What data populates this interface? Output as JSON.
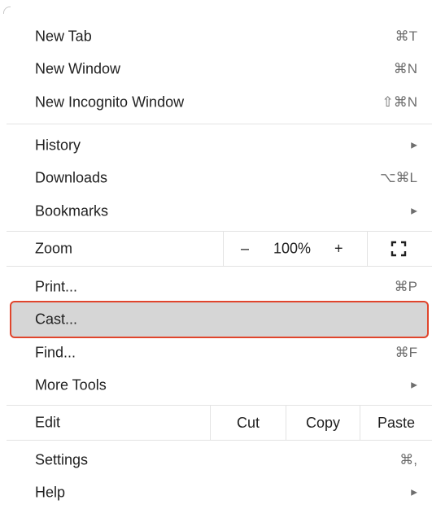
{
  "menu": {
    "new_tab": {
      "label": "New Tab",
      "shortcut": "⌘T"
    },
    "new_window": {
      "label": "New Window",
      "shortcut": "⌘N"
    },
    "new_incognito": {
      "label": "New Incognito Window",
      "shortcut": "⇧⌘N"
    },
    "history": {
      "label": "History"
    },
    "downloads": {
      "label": "Downloads",
      "shortcut": "⌥⌘L"
    },
    "bookmarks": {
      "label": "Bookmarks"
    },
    "zoom": {
      "label": "Zoom",
      "minus": "–",
      "level": "100%",
      "plus": "+"
    },
    "print": {
      "label": "Print...",
      "shortcut": "⌘P"
    },
    "cast": {
      "label": "Cast..."
    },
    "find": {
      "label": "Find...",
      "shortcut": "⌘F"
    },
    "more_tools": {
      "label": "More Tools"
    },
    "edit": {
      "label": "Edit",
      "cut": "Cut",
      "copy": "Copy",
      "paste": "Paste"
    },
    "settings": {
      "label": "Settings",
      "shortcut": "⌘,"
    },
    "help": {
      "label": "Help"
    }
  },
  "icons": {
    "submenu_arrow": "▶"
  },
  "colors": {
    "highlight_border": "#e0452c",
    "highlight_fill": "#d6d6d6"
  }
}
